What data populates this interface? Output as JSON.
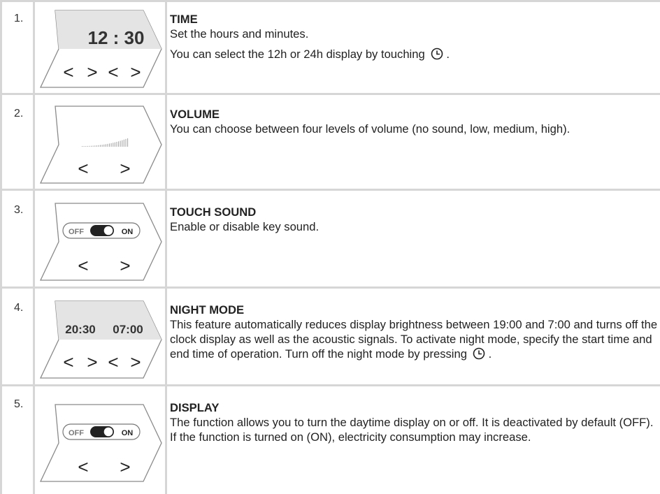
{
  "rows": [
    {
      "number": "1.",
      "title": "TIME",
      "text_1": "Set the hours and minutes.",
      "text_2": "You can select the 12h or 24h display by touching",
      "text_2_end": ".",
      "icon": "timer-icon",
      "panel": {
        "display": "12 : 30",
        "arrows": [
          "<",
          ">",
          "<",
          ">"
        ]
      }
    },
    {
      "number": "2.",
      "title": "VOLUME",
      "text_1": "You can choose between four levels of volume (no sound, low, medium, high).",
      "panel": {
        "indicator": "volume-bars-icon",
        "arrows": [
          "<",
          ">"
        ]
      }
    },
    {
      "number": "3.",
      "title": "TOUCH SOUND",
      "text_1": "Enable or disable key sound.",
      "panel": {
        "toggle_off": "OFF",
        "toggle_on": "ON",
        "arrows": [
          "<",
          ">"
        ]
      }
    },
    {
      "number": "4.",
      "title": "NIGHT MODE",
      "text_1": "This feature automatically reduces display brightness between 19:00 and 7:00 and turns off the clock display as well as the acoustic signals. To activate night mode, specify the start time and end time of operation. Turn off the night mode by pressing",
      "text_1_end": ".",
      "icon": "timer-icon",
      "panel": {
        "start_time": "20:30",
        "end_time": "07:00",
        "arrows": [
          "<",
          ">",
          "<",
          ">"
        ]
      }
    },
    {
      "number": "5.",
      "title": "DISPLAY",
      "text_1": "The function allows you to turn the daytime display on or off. It is deactivated by default (OFF). If the function is turned on (ON), electricity consumption may increase.",
      "panel": {
        "toggle_off": "OFF",
        "toggle_on": "ON",
        "arrows": [
          "<",
          ">"
        ]
      }
    }
  ],
  "colors": {
    "grid": "#d6d6d6",
    "panel_outline": "#8a8a8a",
    "panel_highlight": "#e4e4e4",
    "text": "#222222"
  }
}
